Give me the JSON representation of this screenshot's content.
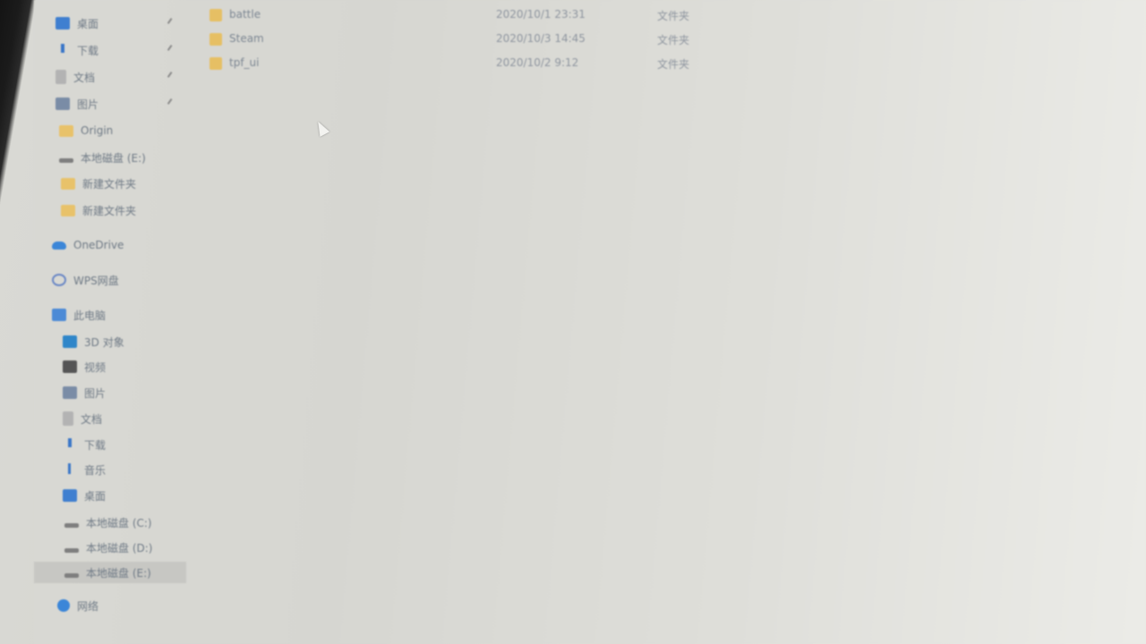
{
  "nav": {
    "items": [
      {
        "label": "桌面",
        "icon": "desktop-icon",
        "pinned": true
      },
      {
        "label": "下载",
        "icon": "download-icon",
        "pinned": true
      },
      {
        "label": "文档",
        "icon": "document-icon",
        "pinned": true
      },
      {
        "label": "图片",
        "icon": "pictures-icon",
        "pinned": true
      },
      {
        "label": "Origin",
        "icon": "folder-icon",
        "pinned": false
      },
      {
        "label": "本地磁盘 (E:)",
        "icon": "drive-icon",
        "pinned": false
      },
      {
        "label": "新建文件夹",
        "icon": "folder-icon",
        "pinned": false
      },
      {
        "label": "新建文件夹",
        "icon": "folder-icon",
        "pinned": false
      },
      {
        "label": "OneDrive",
        "icon": "cloud-icon",
        "pinned": false
      },
      {
        "label": "WPS网盘",
        "icon": "wps-cloud-icon",
        "pinned": false
      },
      {
        "label": "此电脑",
        "icon": "computer-icon",
        "pinned": false
      },
      {
        "label": "3D 对象",
        "icon": "3d-objects-icon",
        "pinned": false
      },
      {
        "label": "视频",
        "icon": "video-icon",
        "pinned": false
      },
      {
        "label": "图片",
        "icon": "pictures-icon",
        "pinned": false
      },
      {
        "label": "文档",
        "icon": "document-icon",
        "pinned": false
      },
      {
        "label": "下载",
        "icon": "download-icon",
        "pinned": false
      },
      {
        "label": "音乐",
        "icon": "music-icon",
        "pinned": false
      },
      {
        "label": "桌面",
        "icon": "desktop-icon",
        "pinned": false
      },
      {
        "label": "本地磁盘 (C:)",
        "icon": "drive-icon",
        "pinned": false
      },
      {
        "label": "本地磁盘 (D:)",
        "icon": "drive-icon",
        "pinned": false
      },
      {
        "label": "本地磁盘 (E:)",
        "icon": "drive-icon",
        "pinned": false,
        "selected": true
      },
      {
        "label": "网络",
        "icon": "network-icon",
        "pinned": false
      }
    ]
  },
  "files": [
    {
      "name": "battle",
      "modified": "2020/10/1 23:31",
      "type": "文件夹"
    },
    {
      "name": "Steam",
      "modified": "2020/10/3 14:45",
      "type": "文件夹"
    },
    {
      "name": "tpf_ui",
      "modified": "2020/10/2 9:12",
      "type": "文件夹"
    }
  ],
  "colors": {
    "folder": "#e6bf64",
    "selected_row": "#c7c7c3",
    "accent_blue": "#3b86d8"
  }
}
